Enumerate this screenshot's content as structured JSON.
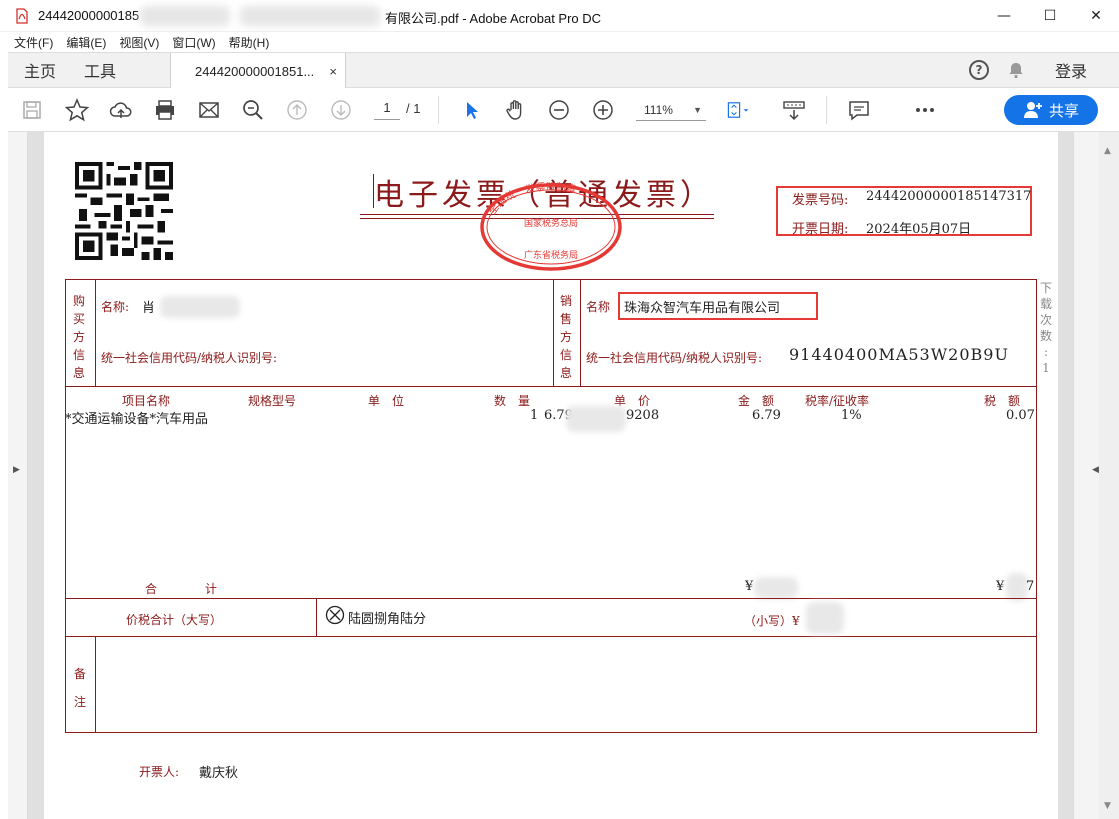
{
  "window": {
    "title_prefix": "24442000000185",
    "title_suffix": "有限公司.pdf - Adobe Acrobat Pro DC",
    "controls": {
      "minimize": "—",
      "maximize": "☐",
      "close": "✕"
    }
  },
  "menu": {
    "items": [
      "文件(F)",
      "编辑(E)",
      "视图(V)",
      "窗口(W)",
      "帮助(H)"
    ]
  },
  "tabs": {
    "home": "主页",
    "tools": "工具",
    "doc": "244420000001851...",
    "doc_close": "×",
    "help": "?",
    "login": "登录"
  },
  "toolbar": {
    "page_current": "1",
    "page_total": "/ 1",
    "zoom": "111%",
    "zoom_arrow": "▼",
    "share_label": "共享"
  },
  "invoice": {
    "title": "电子发票（普通发票）",
    "stamp_top": "全国统一发票监制章",
    "stamp_middle": "国家税务总局",
    "stamp_bottom": "广东省税务局",
    "invoice_no_label": "发票号码:",
    "invoice_no": "24442000000185147317",
    "date_label": "开票日期:",
    "date": "2024年05月07日",
    "buyer_section": [
      "购",
      "买",
      "方",
      "信",
      "息"
    ],
    "buyer_name_label": "名称:",
    "buyer_name": "肖",
    "buyer_tax_label": "统一社会信用代码/纳税人识别号:",
    "seller_section": [
      "销",
      "售",
      "方",
      "信",
      "息"
    ],
    "seller_name_label": "名称",
    "seller_name": "珠海众智汽车用品有限公司",
    "seller_tax_label": "统一社会信用代码/纳税人识别号:",
    "seller_tax_id": "91440400MA53W20B9U",
    "columns": {
      "item": "项目名称",
      "spec": "规格型号",
      "unit": "单　位",
      "qty": "数　量",
      "price": "单　价",
      "amount": "金　额",
      "rate": "税率/征收率",
      "tax": "税　额"
    },
    "row": {
      "item": "*交通运输设备*汽车用品",
      "qty": "1",
      "price_head": "6.79",
      "price_tail": "9208",
      "amount": "6.79",
      "rate": "1%",
      "tax": "0.07"
    },
    "total_label": "合　　　　计",
    "total_amount_symbol": "¥",
    "total_tax_symbol": "¥",
    "total_tax_tail": "7",
    "grand_label": "价税合计（大写）",
    "grand_words": "陆圆捌角陆分",
    "grand_small_label": "（小写）¥",
    "remarks": [
      "备",
      "注"
    ],
    "drawer_label": "开票人:",
    "drawer": "戴庆秋",
    "side_note": [
      "下",
      "载",
      "次",
      "数",
      ":",
      "1"
    ]
  }
}
